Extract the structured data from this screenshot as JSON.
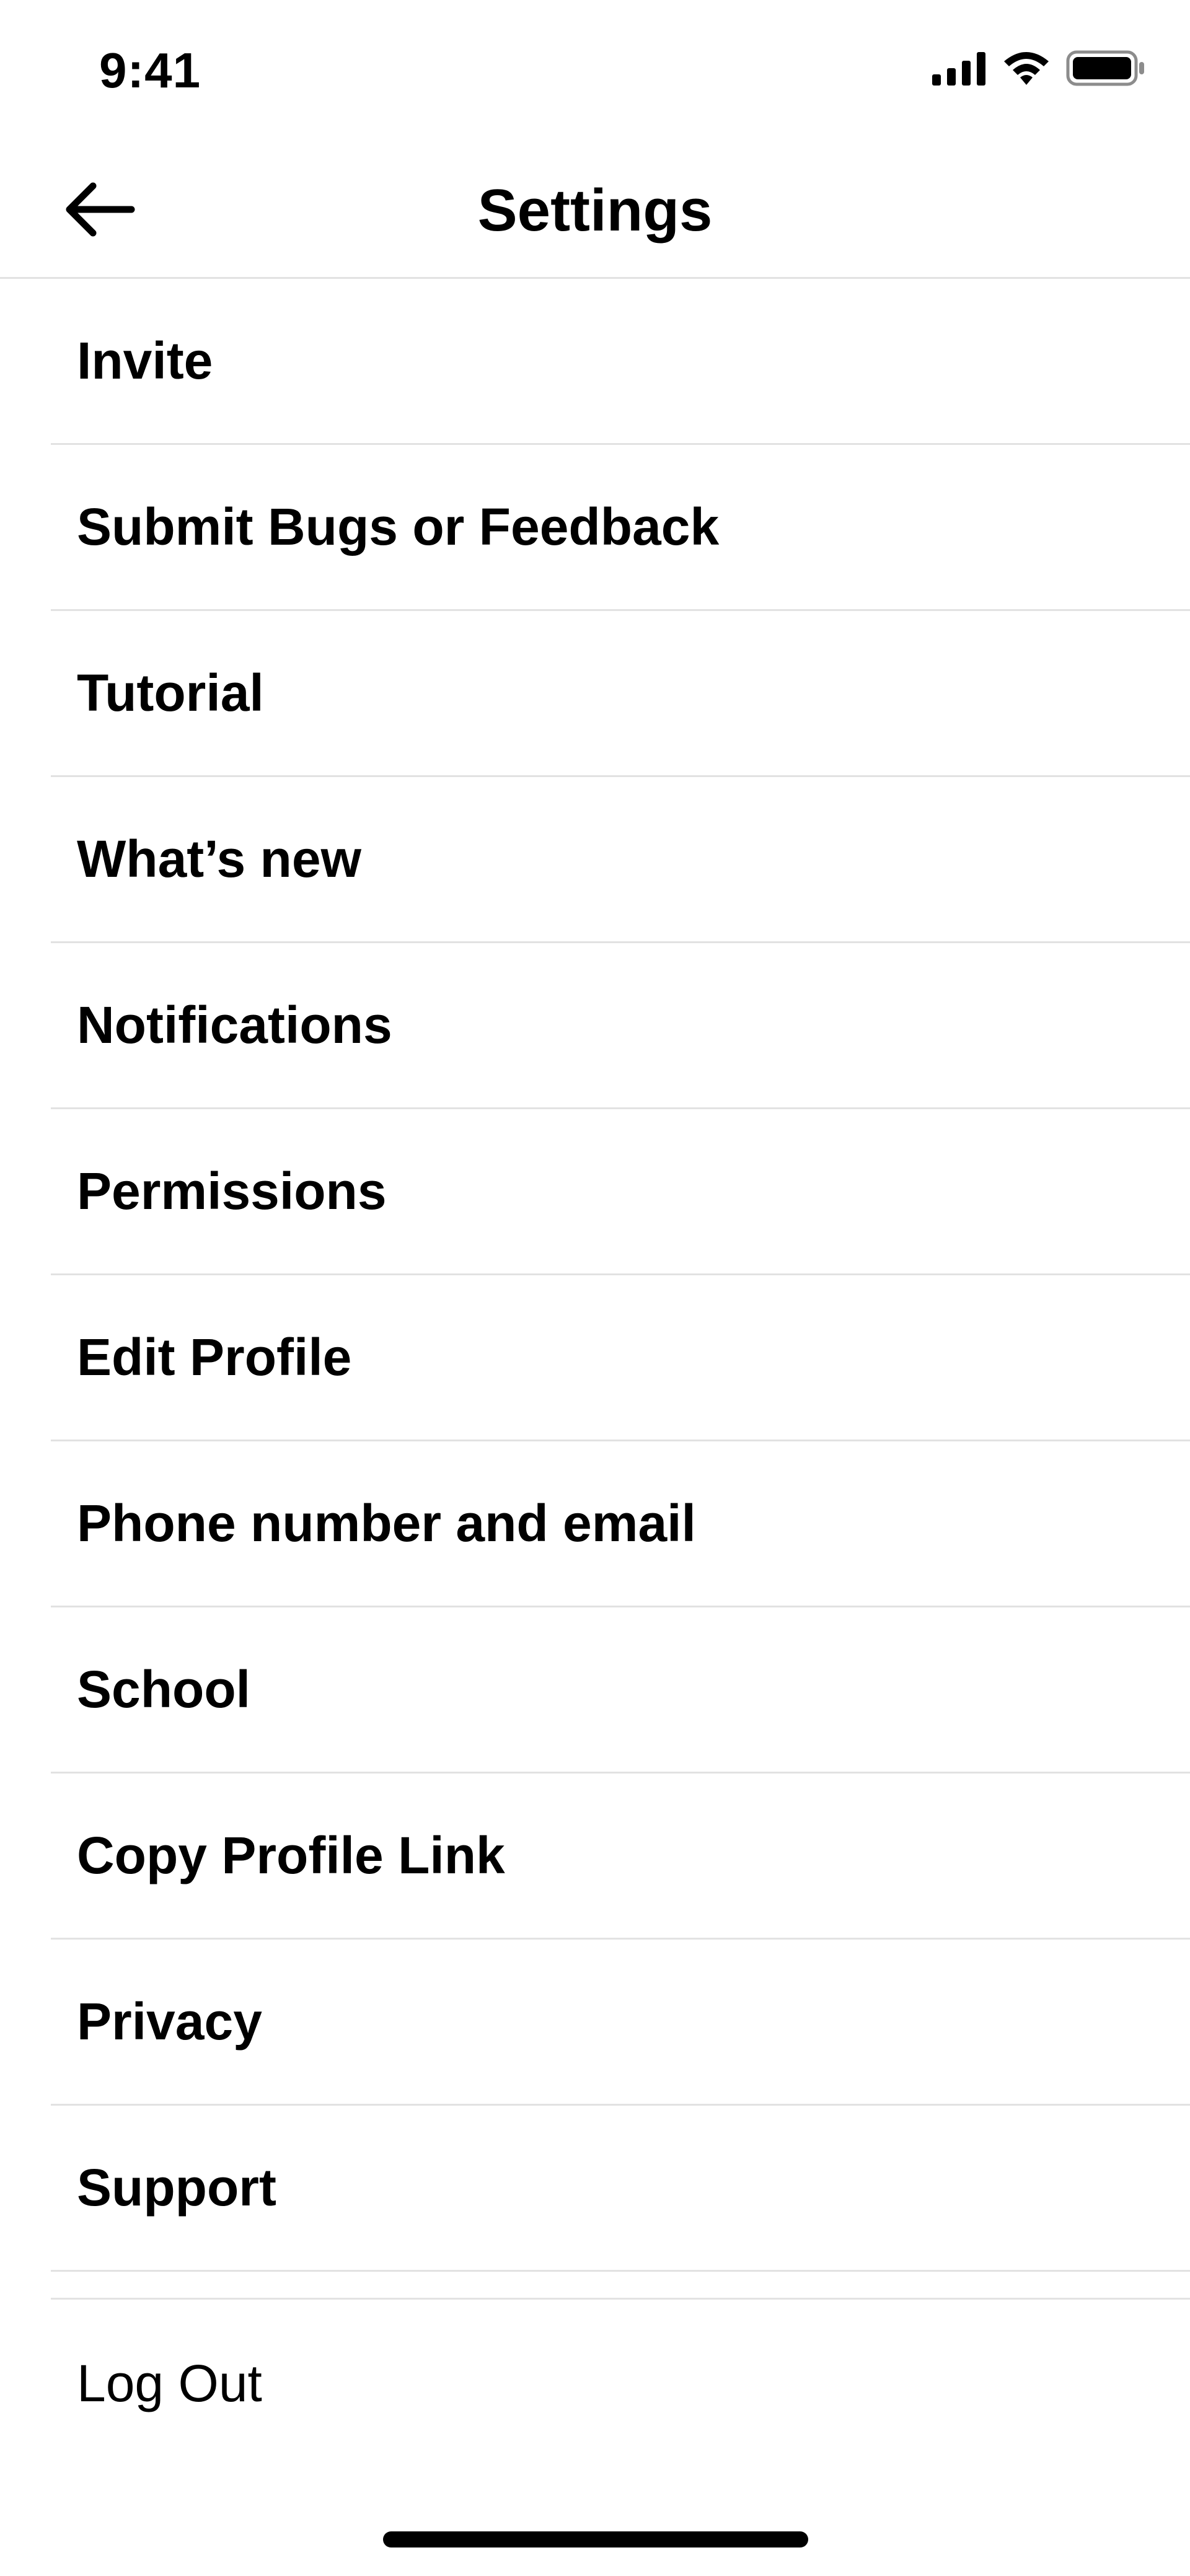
{
  "status_bar": {
    "time": "9:41",
    "icons": [
      "cellular-signal-icon",
      "wifi-icon",
      "battery-icon"
    ]
  },
  "header": {
    "title": "Settings",
    "back_icon": "arrow-left-icon"
  },
  "menu": {
    "items": [
      {
        "label": "Invite"
      },
      {
        "label": "Submit Bugs or Feedback"
      },
      {
        "label": "Tutorial"
      },
      {
        "label": "What’s new"
      },
      {
        "label": "Notifications"
      },
      {
        "label": "Permissions"
      },
      {
        "label": "Edit Profile"
      },
      {
        "label": "Phone number and email"
      },
      {
        "label": "School"
      },
      {
        "label": "Copy Profile Link"
      },
      {
        "label": "Privacy"
      },
      {
        "label": "Support"
      }
    ]
  },
  "footer": {
    "logout_label": "Log Out"
  },
  "colors": {
    "background": "#ffffff",
    "text": "#000000",
    "divider": "#e2e2e2"
  }
}
